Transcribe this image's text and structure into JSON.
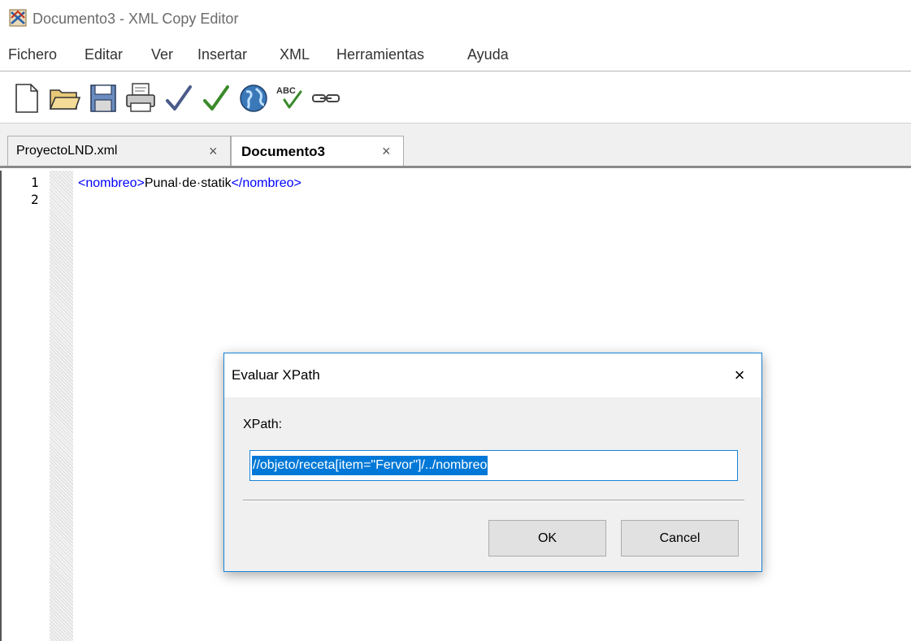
{
  "window": {
    "title": "Documento3 - XML Copy Editor",
    "app_icon": "xml-copy-editor-icon"
  },
  "menubar": {
    "items": [
      "Fichero",
      "Editar",
      "Ver",
      "Insertar",
      "XML",
      "Herramientas",
      "Ayuda"
    ]
  },
  "toolbar": {
    "tools": [
      "new-document-icon",
      "open-folder-icon",
      "save-icon",
      "print-icon",
      "check-wellformed-icon",
      "validate-icon",
      "browser-icon",
      "spellcheck-icon",
      "link-icon"
    ]
  },
  "tabs": [
    {
      "label": "ProyectoLND.xml",
      "active": false,
      "close_glyph": "×"
    },
    {
      "label": "Documento3",
      "active": true,
      "close_glyph": "×"
    }
  ],
  "editor": {
    "line_numbers": [
      "1",
      "2"
    ],
    "line1": {
      "open_tag": "<nombreo>",
      "text": "Punal·de·statik",
      "close_tag": "</nombreo>"
    }
  },
  "dialog": {
    "title": "Evaluar XPath",
    "close_glyph": "×",
    "field_label": "XPath:",
    "xpath_value": "//objeto/receta[item=\"Fervor\"]/../nombreo",
    "ok_label": "OK",
    "cancel_label": "Cancel"
  },
  "colors": {
    "xml_tag": "#0000ff",
    "dialog_border": "#1883d7",
    "selection": "#0078d7"
  }
}
